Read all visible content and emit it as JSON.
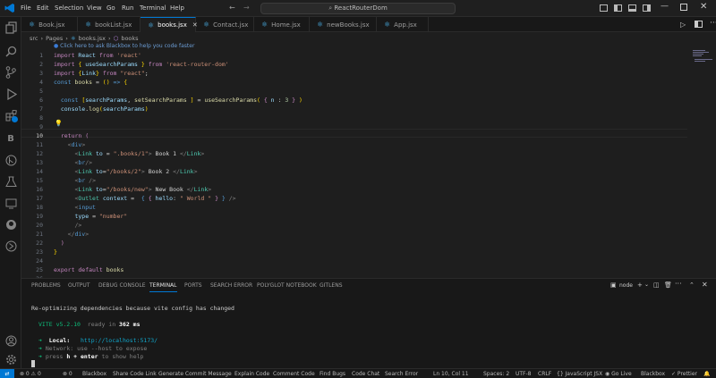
{
  "menu": [
    "File",
    "Edit",
    "Selection",
    "View",
    "Go",
    "Run",
    "Terminal",
    "Help"
  ],
  "search": {
    "text": "ReactRouterDom"
  },
  "tabs": [
    {
      "label": "Book.jsx",
      "active": false
    },
    {
      "label": "bookList.jsx",
      "active": false
    },
    {
      "label": "books.jsx",
      "active": true
    },
    {
      "label": "Contact.jsx",
      "active": false
    },
    {
      "label": "Home.jsx",
      "active": false
    },
    {
      "label": "newBooks.jsx",
      "active": false
    },
    {
      "label": "App.jsx",
      "active": false
    }
  ],
  "breadcrumb": {
    "p1": "src",
    "p2": "Pages",
    "p3": "books.jsx",
    "p4": "books"
  },
  "editor": {
    "hint": "Click here to ask Blackbox to help you code faster",
    "line_numbers": [
      "1",
      "2",
      "3",
      "4",
      "5",
      "6",
      "7",
      "8",
      "9",
      "10",
      "11",
      "12",
      "13",
      "14",
      "15",
      "16",
      "17",
      "18",
      "19",
      "20",
      "21",
      "22",
      "23",
      "24",
      "25",
      "26"
    ]
  },
  "panel": {
    "tabs": [
      "PROBLEMS",
      "OUTPUT",
      "DEBUG CONSOLE",
      "TERMINAL",
      "PORTS",
      "SEARCH ERROR",
      "POLYGLOT NOTEBOOK",
      "GITLENS"
    ],
    "active_tab": "TERMINAL",
    "shell": "node",
    "terminal": {
      "line1": "Re-optimizing dependencies because vite config has changed",
      "vite": "VITE v5.2.10",
      "ready": "ready in",
      "ms": "362 ms",
      "local_label": "Local:",
      "local_url": "http://localhost:5173/",
      "network": "Network: use --host to expose",
      "help_pre": "press ",
      "help_key": "h + enter",
      "help_post": " to show help"
    }
  },
  "status": {
    "left": [
      "⊗ 0 ⚠ 0",
      "⊗ 0",
      "Blackbox",
      "Share Code Link",
      "Generate Commit Message",
      "Explain Code",
      "Comment Code",
      "Find Bugs",
      "Code Chat",
      "Search Error"
    ],
    "right": [
      "Ln 10, Col 11",
      "Spaces: 2",
      "UTF-8",
      "CRLF",
      "{} JavaScript JSX",
      "Go Live",
      "Blackbox",
      "✓ Prettier"
    ]
  }
}
